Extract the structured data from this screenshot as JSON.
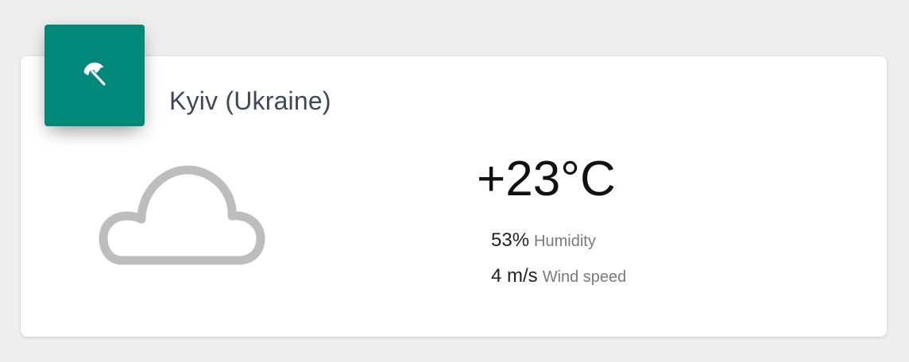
{
  "widget": {
    "header_icon": "beach-umbrella-icon",
    "accent_color": "#00897b",
    "location": "Kyiv (Ukraine)",
    "condition_icon": "cloud-icon",
    "temperature": "+23°C",
    "humidity": {
      "value": "53%",
      "label": "Humidity"
    },
    "wind": {
      "value": "4 m/s",
      "label": "Wind speed"
    }
  }
}
